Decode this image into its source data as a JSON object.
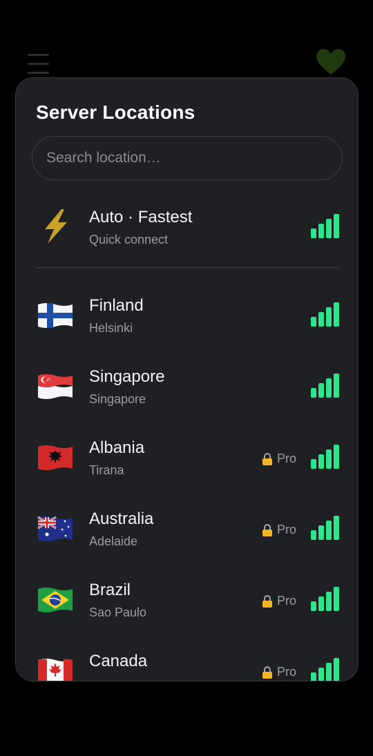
{
  "header": {
    "menu_icon": "hamburger-menu-icon",
    "favorite_icon": "heart-icon"
  },
  "sheet": {
    "title": "Server Locations",
    "search": {
      "placeholder": "Search location…",
      "value": ""
    }
  },
  "auto": {
    "icon": "lightning-bolt-icon",
    "label": "Auto · Fastest",
    "sub": "Quick connect",
    "signal_bars": 4
  },
  "locations": [
    {
      "country": "Finland",
      "city": "Helsinki",
      "flag": "finland-flag-icon",
      "pro": false,
      "signal_bars": 4
    },
    {
      "country": "Singapore",
      "city": "Singapore",
      "flag": "singapore-flag-icon",
      "pro": false,
      "signal_bars": 4
    },
    {
      "country": "Albania",
      "city": "Tirana",
      "flag": "albania-flag-icon",
      "pro": true,
      "pro_label": "Pro",
      "signal_bars": 4
    },
    {
      "country": "Australia",
      "city": "Adelaide",
      "flag": "australia-flag-icon",
      "pro": true,
      "pro_label": "Pro",
      "signal_bars": 4
    },
    {
      "country": "Brazil",
      "city": "Sao Paulo",
      "flag": "brazil-flag-icon",
      "pro": true,
      "pro_label": "Pro",
      "signal_bars": 4
    },
    {
      "country": "Canada",
      "city": "",
      "flag": "canada-flag-icon",
      "pro": true,
      "pro_label": "Pro",
      "signal_bars": 4
    }
  ],
  "colors": {
    "background": "#000000",
    "sheet": "#1e2024",
    "signal": "#2ee68a",
    "bolt": "#c9a227",
    "heart": "#1f3a0f"
  }
}
